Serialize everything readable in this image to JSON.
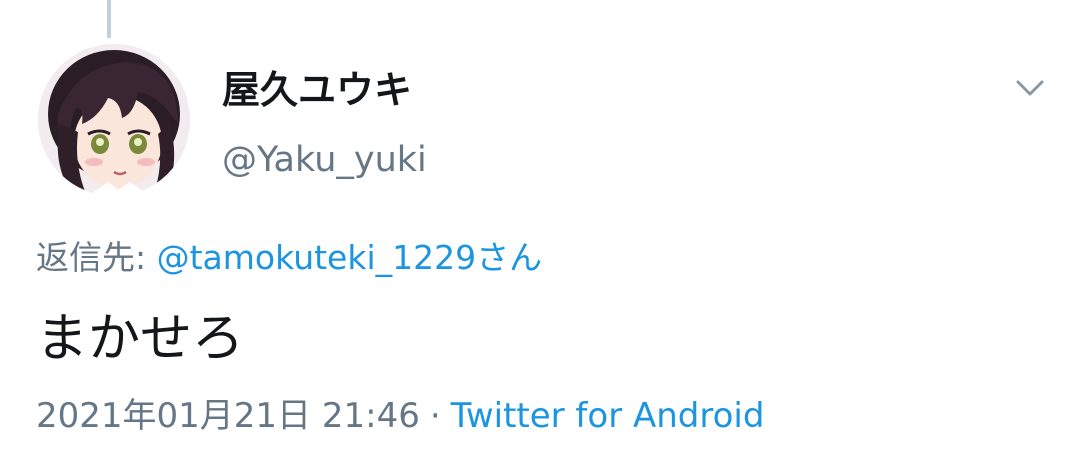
{
  "tweet": {
    "author": {
      "display_name": "屋久ユウキ",
      "handle": "@Yaku_yuki",
      "avatar_icon": "avatar-anime-girl-icon"
    },
    "menu_icon": "chevron-down-icon",
    "reply_to": {
      "prefix": "返信先: ",
      "mention": "@tamokuteki_1229さん"
    },
    "text": "まかせろ",
    "timestamp": "2021年01月21日 21:46",
    "separator": "·",
    "source": "Twitter for Android"
  },
  "colors": {
    "text_primary": "#14171a",
    "text_secondary": "#657786",
    "link": "#1b95e0",
    "thread_line": "#c4cfd6"
  }
}
